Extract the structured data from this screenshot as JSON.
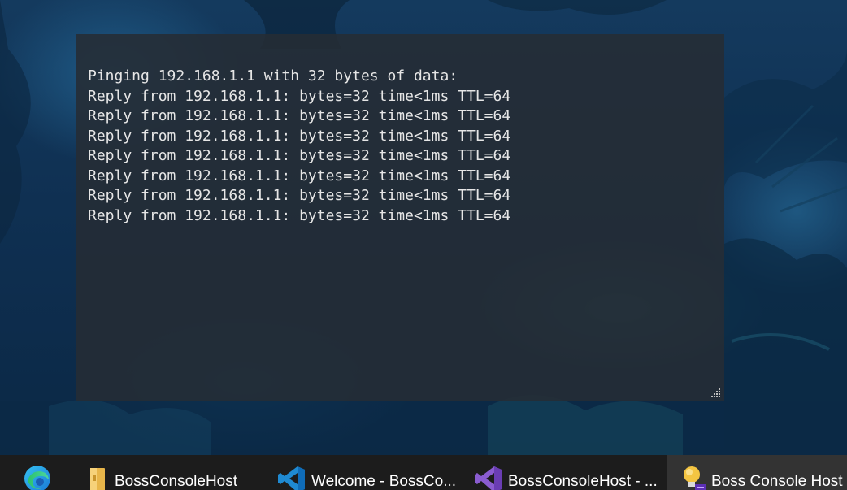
{
  "console": {
    "lines": [
      "Pinging 192.168.1.1 with 32 bytes of data:",
      "Reply from 192.168.1.1: bytes=32 time<1ms TTL=64",
      "Reply from 192.168.1.1: bytes=32 time<1ms TTL=64",
      "Reply from 192.168.1.1: bytes=32 time<1ms TTL=64",
      "Reply from 192.168.1.1: bytes=32 time<1ms TTL=64",
      "Reply from 192.168.1.1: bytes=32 time<1ms TTL=64",
      "Reply from 192.168.1.1: bytes=32 time<1ms TTL=64",
      "Reply from 192.168.1.1: bytes=32 time<1ms TTL=64"
    ],
    "text_color": "#e6e6e6",
    "background_color": "#262c34"
  },
  "taskbar": {
    "items": [
      {
        "label": "BossConsoleHost",
        "icon": "folder-icon",
        "active": false
      },
      {
        "label": "Welcome - BossCo...",
        "icon": "vscode-icon",
        "active": false
      },
      {
        "label": "BossConsoleHost - ...",
        "icon": "visual-studio-icon",
        "active": false
      },
      {
        "label": "Boss Console Host",
        "icon": "lightbulb-icon",
        "active": true
      }
    ],
    "pinned_icon": "edge-icon"
  }
}
